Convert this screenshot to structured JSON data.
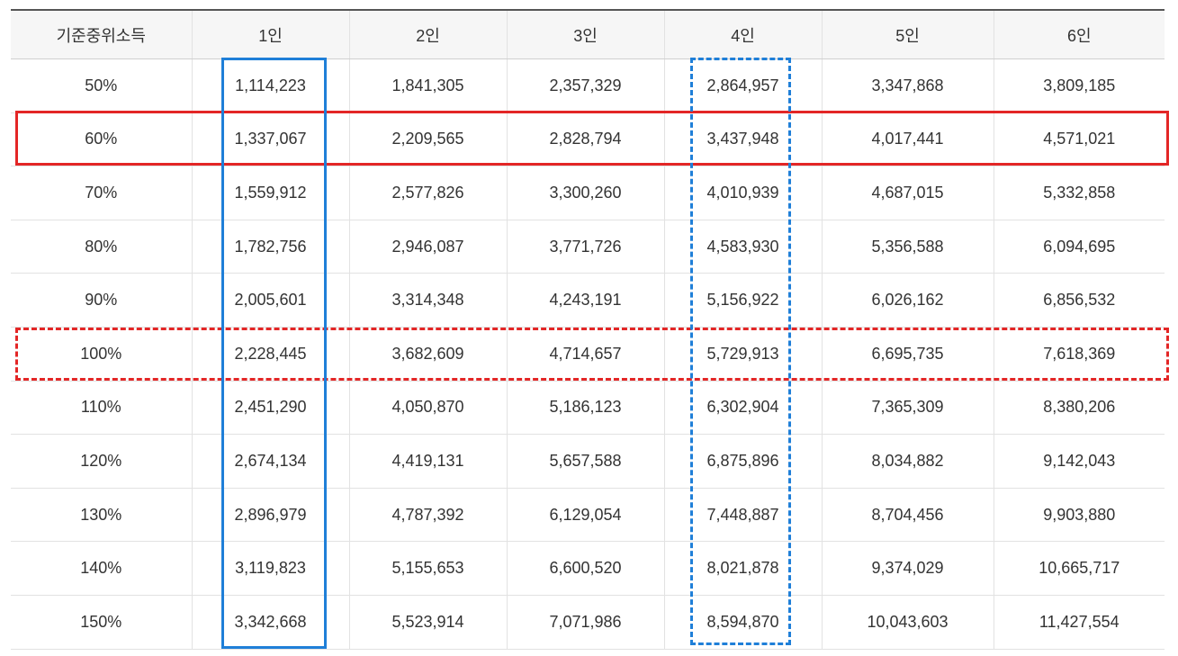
{
  "table": {
    "headers": [
      "기준중위소득",
      "1인",
      "2인",
      "3인",
      "4인",
      "5인",
      "6인"
    ],
    "rows": [
      [
        "50%",
        "1,114,223",
        "1,841,305",
        "2,357,329",
        "2,864,957",
        "3,347,868",
        "3,809,185"
      ],
      [
        "60%",
        "1,337,067",
        "2,209,565",
        "2,828,794",
        "3,437,948",
        "4,017,441",
        "4,571,021"
      ],
      [
        "70%",
        "1,559,912",
        "2,577,826",
        "3,300,260",
        "4,010,939",
        "4,687,015",
        "5,332,858"
      ],
      [
        "80%",
        "1,782,756",
        "2,946,087",
        "3,771,726",
        "4,583,930",
        "5,356,588",
        "6,094,695"
      ],
      [
        "90%",
        "2,005,601",
        "3,314,348",
        "4,243,191",
        "5,156,922",
        "6,026,162",
        "6,856,532"
      ],
      [
        "100%",
        "2,228,445",
        "3,682,609",
        "4,714,657",
        "5,729,913",
        "6,695,735",
        "7,618,369"
      ],
      [
        "110%",
        "2,451,290",
        "4,050,870",
        "5,186,123",
        "6,302,904",
        "7,365,309",
        "8,380,206"
      ],
      [
        "120%",
        "2,674,134",
        "4,419,131",
        "5,657,588",
        "6,875,896",
        "8,034,882",
        "9,142,043"
      ],
      [
        "130%",
        "2,896,979",
        "4,787,392",
        "6,129,054",
        "7,448,887",
        "8,704,456",
        "9,903,880"
      ],
      [
        "140%",
        "3,119,823",
        "5,155,653",
        "6,600,520",
        "8,021,878",
        "9,374,029",
        "10,665,717"
      ],
      [
        "150%",
        "3,342,668",
        "5,523,914",
        "7,071,986",
        "8,594,870",
        "10,043,603",
        "11,427,554"
      ]
    ]
  },
  "highlights": {
    "row_solid": "60%",
    "row_dashed": "100%",
    "column_solid": "1인",
    "column_dashed": "4인",
    "red_color": "#e32626",
    "blue_color": "#1f7fd8"
  }
}
